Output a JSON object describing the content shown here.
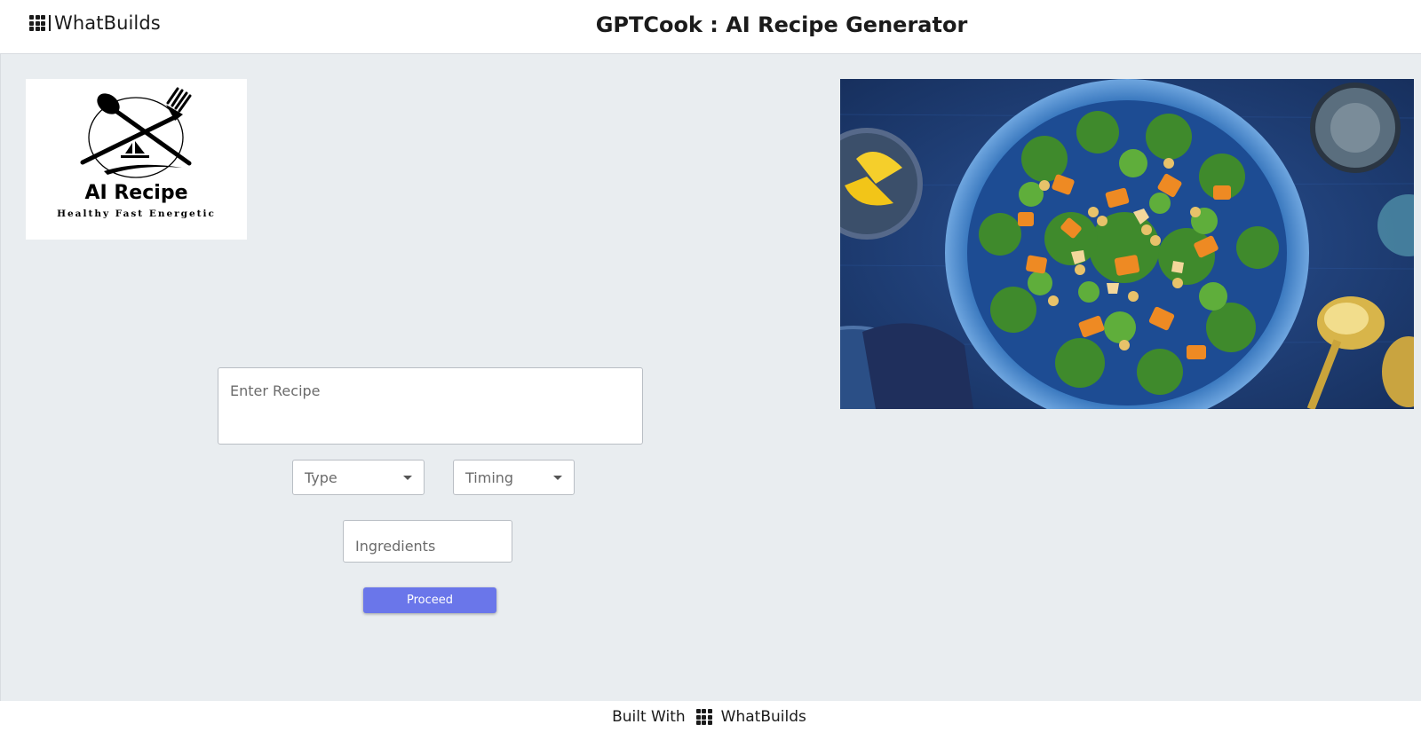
{
  "header": {
    "brand_name": "WhatBuilds",
    "page_title": "GPTCook : AI Recipe Generator"
  },
  "logo": {
    "title": "AI Recipe",
    "subtitle": "Healthy Fast Energetic"
  },
  "form": {
    "recipe_placeholder": "Enter Recipe",
    "type_label": "Type",
    "timing_label": "Timing",
    "ingredients_placeholder": "Ingredients",
    "proceed_label": "Proceed"
  },
  "footer": {
    "built_with_label": "Built With",
    "brand_name": "WhatBuilds"
  },
  "colors": {
    "background": "#e9edf0",
    "button": "#6a76ea",
    "plate": "#2f6fb8"
  }
}
